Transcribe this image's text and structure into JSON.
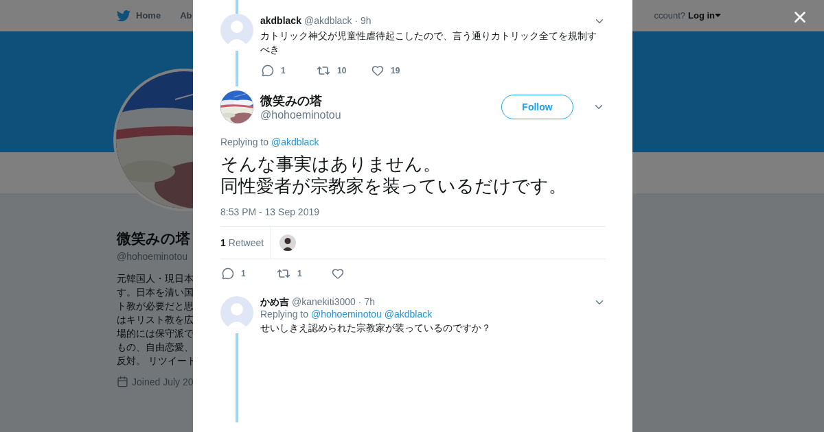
{
  "nav": {
    "items": [
      {
        "label": "Home",
        "kind": "logo"
      },
      {
        "label": "Ab",
        "kind": "plain"
      }
    ],
    "login_prompt": "ccount?",
    "login_link": "Log in"
  },
  "profile": {
    "name": "微笑みの塔",
    "handle": "@hohoeminotou",
    "bio_lines": [
      "元韓国人・現日本",
      "す。日本を清い国",
      "ト教が必要だと思",
      "はキリスト教を広",
      "場的には保守派で",
      "もの、自由恋愛、",
      "反対。 リツイート"
    ],
    "joined": "Joined July 20"
  },
  "thread": [
    {
      "kind": "reply",
      "name": "akdblack",
      "handle": "@akdblack",
      "time": "· 9h",
      "text": "カトリック神父が児童性虐待起こしたので、言う通りカトリック全てを規制すべき",
      "replies": "1",
      "retweets": "10",
      "likes": "19"
    },
    {
      "kind": "focused",
      "name": "微笑みの塔",
      "handle": "@hohoeminotou",
      "follow": "Follow",
      "replying_label": "Replying to",
      "replying_to": [
        "@akdblack"
      ],
      "text_lines": [
        "そんな事実はありません。",
        "同性愛者が宗教家を装っているだけです。"
      ],
      "date": "8:53 PM - 13 Sep 2019",
      "retweet_count": "1",
      "retweet_label": "Retweet",
      "replies": "1",
      "retweets": "1"
    },
    {
      "kind": "reply",
      "name": "かめ吉",
      "handle": "@kanekiti3000",
      "time": "· 7h",
      "replying_label": "Replying to",
      "replying_to": [
        "@hohoeminotou",
        "@akdblack"
      ],
      "text": "せいしきえ認められた宗教家が装っているのですか？"
    }
  ]
}
